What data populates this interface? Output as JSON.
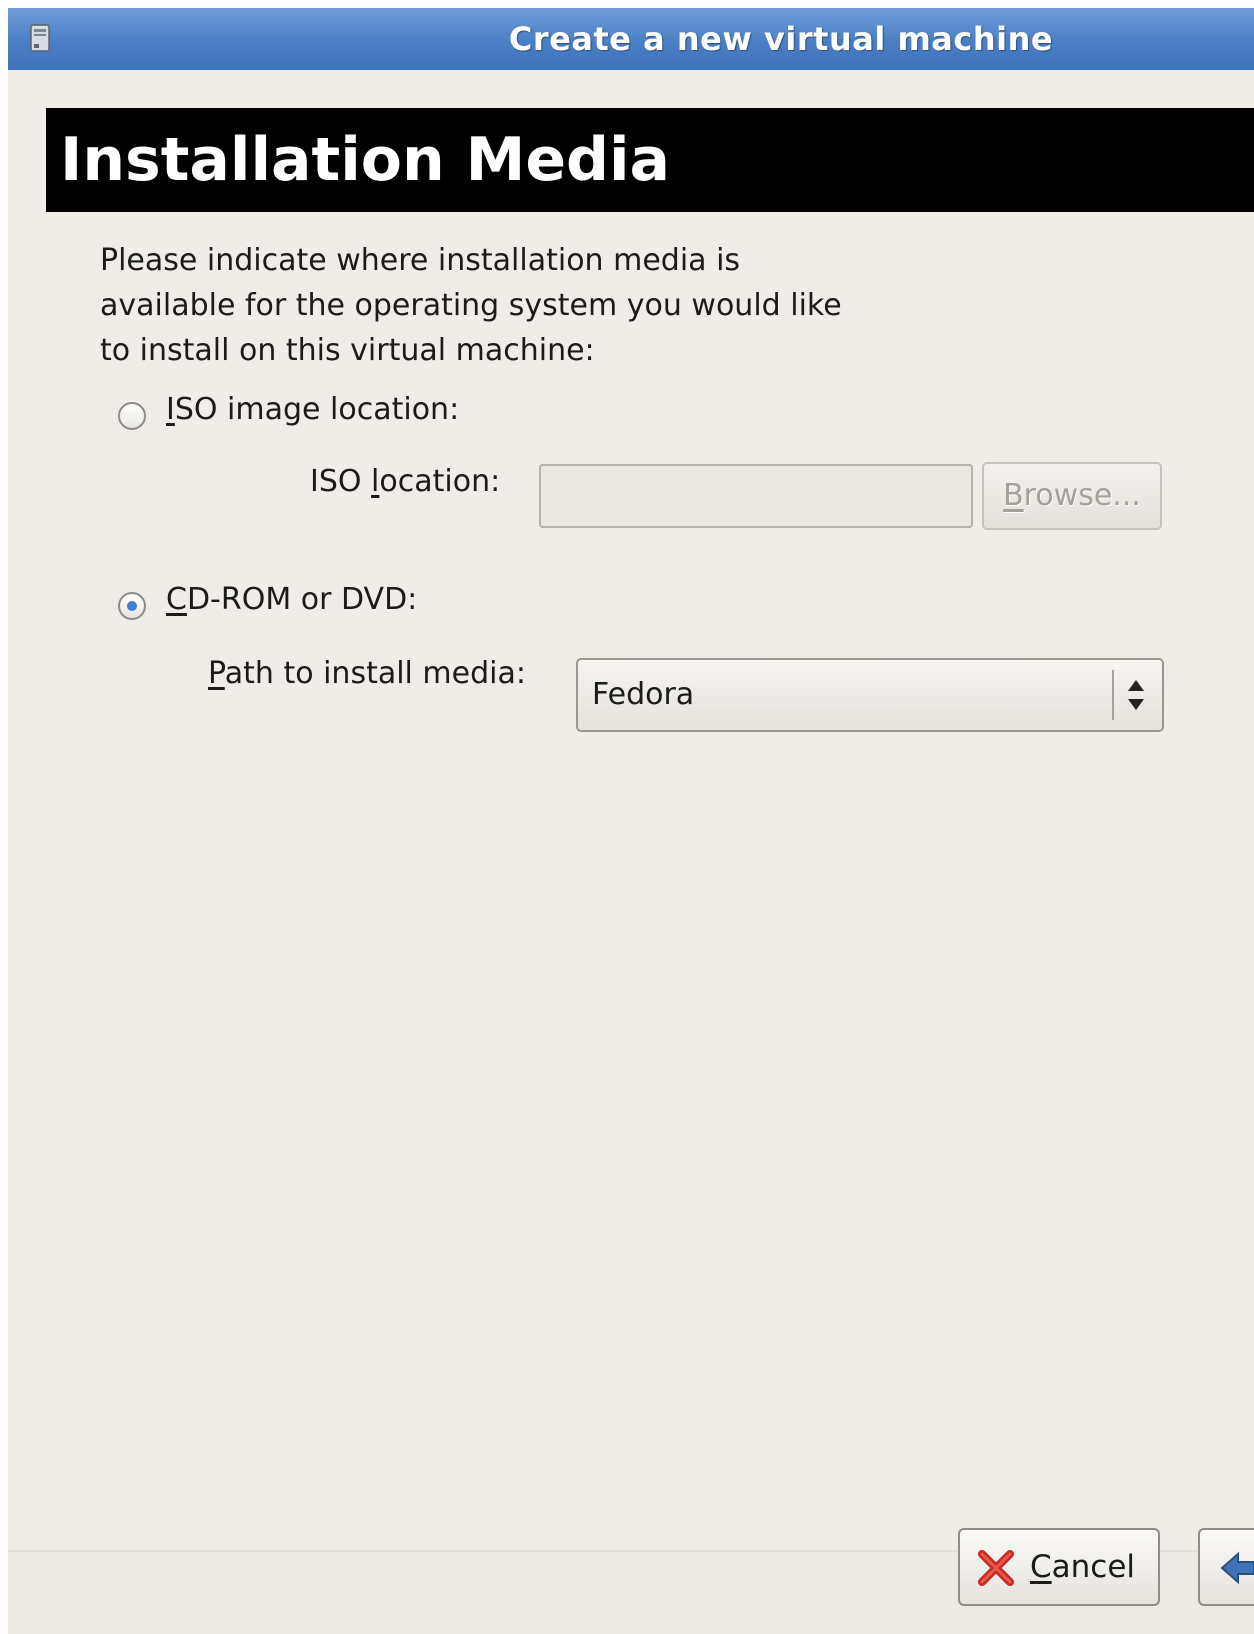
{
  "window": {
    "title": "Create a new virtual machine"
  },
  "banner": {
    "title": "Installation Media"
  },
  "instructions": {
    "line1": "Please indicate where installation media is",
    "line2": "available for the operating system you would like",
    "line3": "to install on this virtual machine:"
  },
  "iso_option": {
    "label_first": "I",
    "label_rest": "SO image location:",
    "selected": false,
    "location_label_pre": "ISO ",
    "location_label_u": "l",
    "location_label_post": "ocation:",
    "location_value": "",
    "browse_first": "B",
    "browse_rest": "rowse..."
  },
  "cdrom_option": {
    "label_first": "C",
    "label_rest": "D-ROM or DVD:",
    "selected": true,
    "path_label_first": "P",
    "path_label_rest": "ath to install media:",
    "path_value": "Fedora"
  },
  "buttons": {
    "cancel_first": "C",
    "cancel_rest": "ancel"
  },
  "colors": {
    "titlebar": "#4a7fc5",
    "banner_bg": "#000000",
    "window_bg": "#edeae5",
    "cancel_icon": "#c8281e",
    "back_icon": "#3f73b8"
  },
  "icons": {
    "title": "computer-icon",
    "cancel": "cancel-x-icon",
    "back": "back-arrow-icon",
    "combo": "up-down-arrows-icon"
  }
}
